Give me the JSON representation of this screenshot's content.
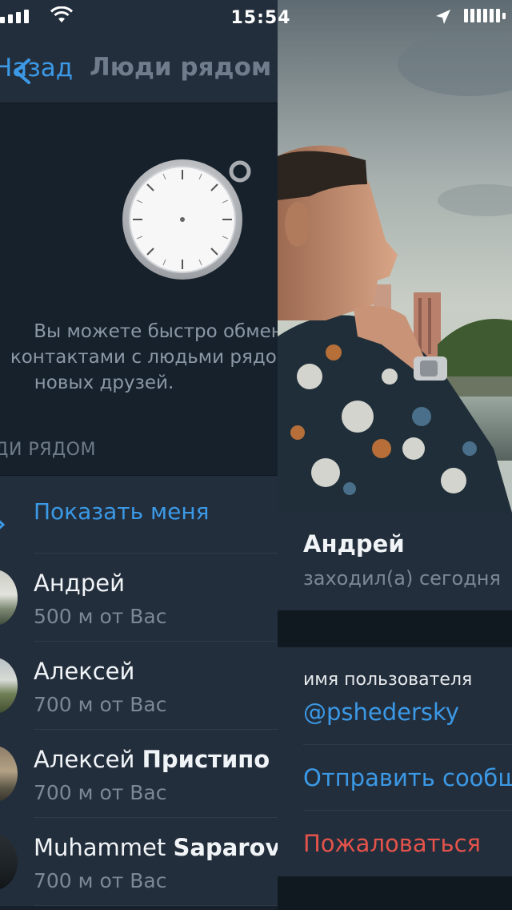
{
  "status_bar": {
    "time": "15:54"
  },
  "nearby": {
    "back_label": "Назад",
    "title": "Люди рядом",
    "hint_lines": [
      "Вы можете быстро обмен",
      "контактами с людьми рядом",
      "новых друзей."
    ],
    "section_header": "ЛЮДИ РЯДОМ",
    "show_me_label": "Показать меня",
    "people": [
      {
        "name": "Андрей",
        "name_bold": "",
        "distance": "500 м от Вас"
      },
      {
        "name": "Алексей",
        "name_bold": "",
        "distance": "700 м от Вас"
      },
      {
        "name": "Алексей ",
        "name_bold": "Пристипо",
        "distance": "700 м от Вас"
      },
      {
        "name": "Muhammet ",
        "name_bold": "Saparov",
        "distance": "700 м от Вас"
      }
    ]
  },
  "profile": {
    "name": "Андрей",
    "last_seen": "заходил(а) сегодня",
    "username_label": "имя пользователя",
    "username": "@pshedersky",
    "send_message": "Отправить сообщение",
    "report": "Пожаловаться"
  },
  "colors": {
    "accent": "#3b99e6",
    "danger": "#e5534b",
    "background": "#17212b",
    "surface": "#232e3c"
  }
}
